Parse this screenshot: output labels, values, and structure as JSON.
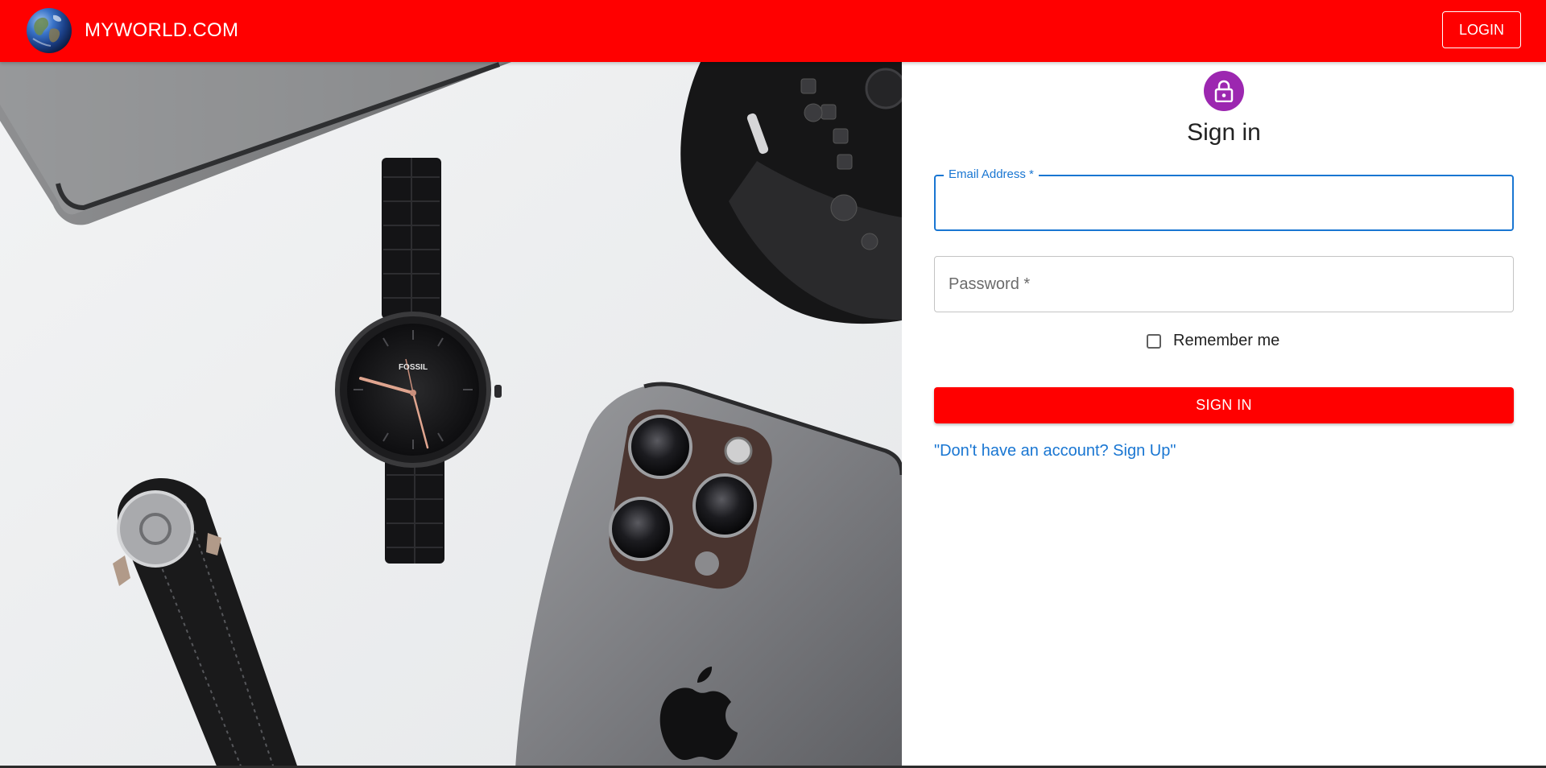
{
  "header": {
    "brand": "MYWORLD.COM",
    "login_label": "LOGIN"
  },
  "form": {
    "title": "Sign in",
    "email_label": "Email Address *",
    "password_label": "Password *",
    "remember_label": "Remember me",
    "signin_label": "SIGN IN",
    "signup_link": "\"Don't have an account? Sign Up\""
  },
  "hero": {
    "watch_brand": "FOSSIL"
  },
  "icons": {
    "logo": "globe-icon",
    "avatar": "lock-icon"
  },
  "colors": {
    "primary": "#ff0000",
    "accent": "#1976d2",
    "avatar": "#9c27b0"
  }
}
